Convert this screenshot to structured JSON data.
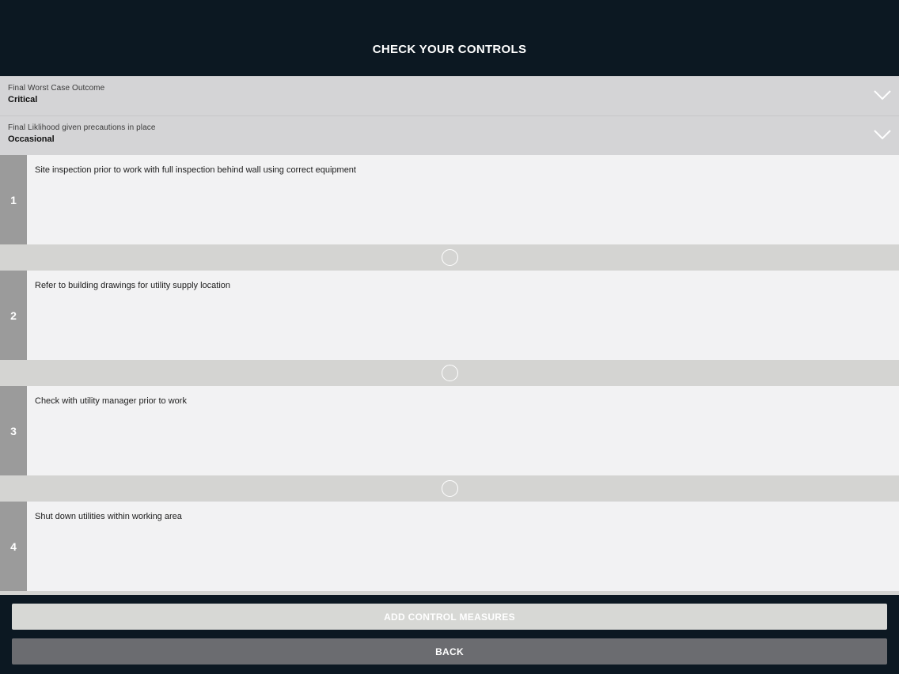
{
  "header": {
    "title": "CHECK YOUR CONTROLS"
  },
  "selects": [
    {
      "label": "Final Worst Case Outcome",
      "value": "Critical",
      "icon": "chevron-down-icon"
    },
    {
      "label": "Final Liklihood given precautions in place",
      "value": "Occasional",
      "icon": "chevron-down-icon"
    }
  ],
  "measures": [
    {
      "number": "1",
      "text": "Site inspection prior to work with full inspection behind wall using correct equipment"
    },
    {
      "number": "2",
      "text": "Refer to building drawings for utility supply location"
    },
    {
      "number": "3",
      "text": "Check with utility manager prior to work"
    },
    {
      "number": "4",
      "text": "Shut down utilities within working area"
    }
  ],
  "footer": {
    "add_label": "ADD CONTROL MEASURES",
    "back_label": "BACK"
  },
  "colors": {
    "background": "#0c1822",
    "number_column": "#9b9b9b",
    "row_background": "#f2f2f3",
    "back_button": "#6b6c70"
  }
}
